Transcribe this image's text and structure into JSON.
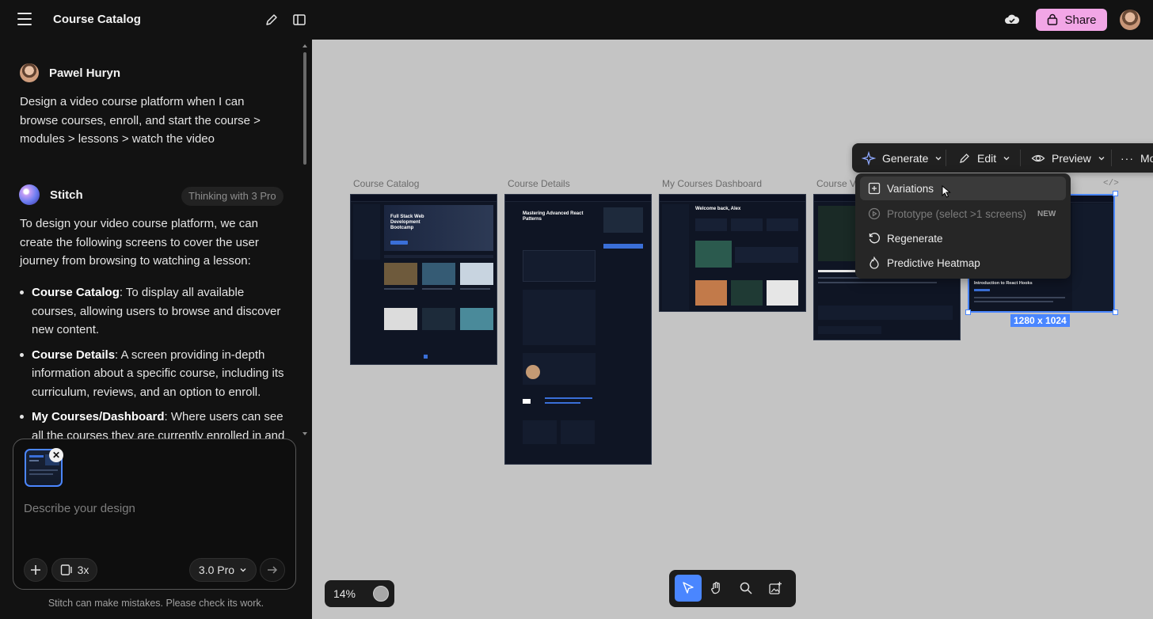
{
  "topbar": {
    "title": "Course Catalog",
    "share_label": "Share"
  },
  "chat": {
    "user": {
      "name": "Pawel Huryn",
      "message": "Design a video course platform when I can browse courses, enroll, and start the course > modules > lessons > watch the video"
    },
    "assistant": {
      "name": "Stitch",
      "badge": "Thinking with 3 Pro",
      "intro": "To design your video course platform, we can create the following screens to cover the user journey from browsing to watching a lesson:",
      "bullets": [
        {
          "title": "Course Catalog",
          "text": ": To display all available courses, allowing users to browse and discover new content."
        },
        {
          "title": "Course Details",
          "text": ": A screen providing in-depth information about a specific course, including its curriculum, reviews, and an option to enroll."
        },
        {
          "title": "My Courses/Dashboard",
          "text": ": Where users can see all the courses they are currently enrolled in and"
        }
      ]
    }
  },
  "composer": {
    "placeholder": "Describe your design",
    "variants_label": "3x",
    "model_label": "3.0 Pro",
    "disclaimer": "Stitch can make mistakes. Please check its work."
  },
  "canvas": {
    "screens": [
      {
        "label": "Course Catalog"
      },
      {
        "label": "Course Details"
      },
      {
        "label": "My Courses Dashboard"
      },
      {
        "label": "Course Vi"
      }
    ],
    "previews": {
      "catalog_hero": "Full Stack Web Development Bootcamp",
      "details_hero": "Mastering Advanced React Patterns",
      "dashboard_welcome": "Welcome back, Alex",
      "lesson_title": "Introduction to React Hooks"
    },
    "toolbar": {
      "generate": "Generate",
      "edit": "Edit",
      "preview": "Preview",
      "more": "Mo"
    },
    "dropdown": {
      "variations": "Variations",
      "prototype": "Prototype (select >1 screens)",
      "prototype_badge": "NEW",
      "regenerate": "Regenerate",
      "heatmap": "Predictive Heatmap"
    },
    "selection_size": "1280 x 1024",
    "zoom": "14%",
    "code_icon": "</>"
  },
  "icons": {
    "menu": "hamburger-icon",
    "edit": "pencil-icon",
    "sidebar": "sidebar-toggle-icon",
    "sync": "cloud-check-icon",
    "share": "lock-icon"
  },
  "colors": {
    "accent": "#4a86ff",
    "share": "#f2a6e6",
    "canvas": "#c4c4c4",
    "panel": "#121212"
  }
}
